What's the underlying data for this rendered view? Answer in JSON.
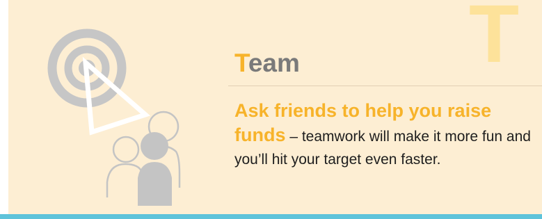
{
  "big_letter": "T",
  "heading": {
    "first_letter": "T",
    "rest": "eam"
  },
  "body": {
    "highlight": "Ask friends to help you raise funds",
    "text": " – teamwork will make it more fun and you’ll hit your target even faster."
  },
  "illustration": {
    "icons": [
      "target-icon",
      "pointer-triangle-icon",
      "people-icon"
    ]
  },
  "colors": {
    "background": "#fdeed3",
    "accent": "#f7b32a",
    "big_letter": "#fde29a",
    "title_gray": "#7a7a7a",
    "icon_gray": "#c4c4c4",
    "bottom_line": "#5ec3da"
  }
}
